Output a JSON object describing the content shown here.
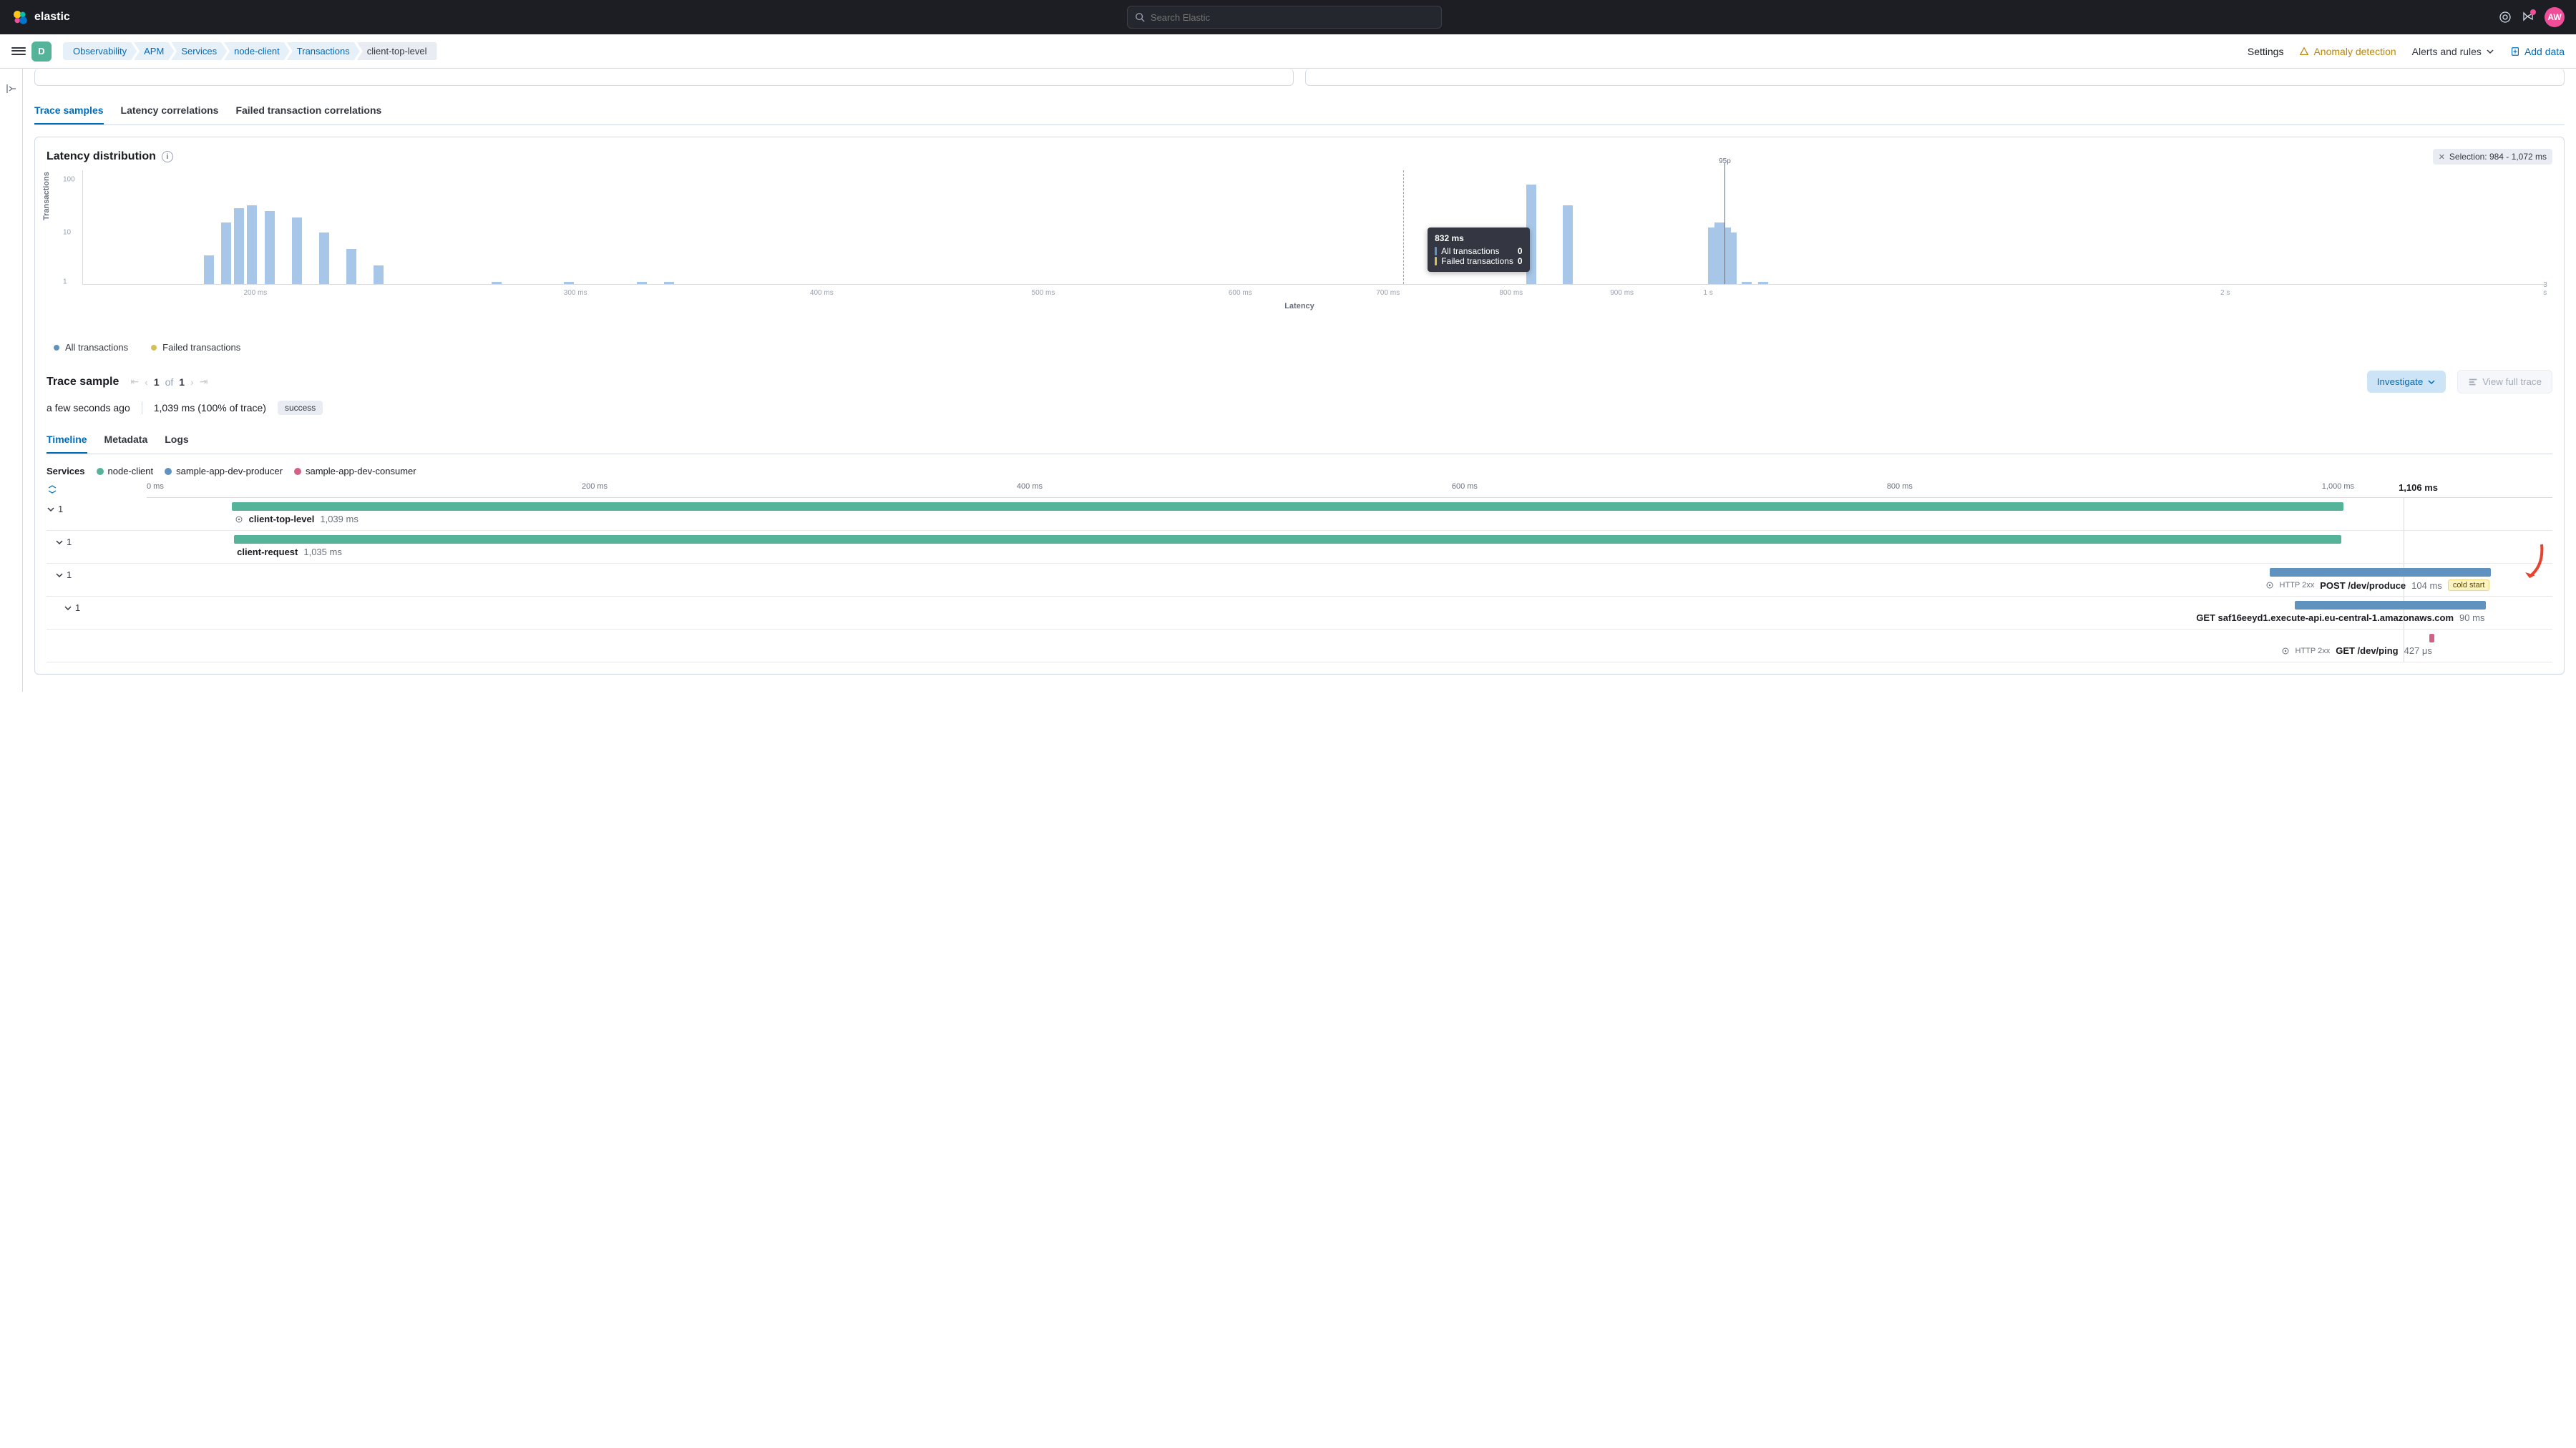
{
  "header": {
    "logo_text": "elastic",
    "search_placeholder": "Search Elastic",
    "avatar_initials": "AW"
  },
  "subheader": {
    "space_initial": "D",
    "breadcrumbs": [
      "Observability",
      "APM",
      "Services",
      "node-client",
      "Transactions",
      "client-top-level"
    ],
    "links": {
      "settings": "Settings",
      "anomaly": "Anomaly detection",
      "alerts": "Alerts and rules",
      "add_data": "Add data"
    }
  },
  "topTabs": [
    "Trace samples",
    "Latency correlations",
    "Failed transaction correlations"
  ],
  "latencyPanel": {
    "title": "Latency distribution",
    "selection_label": "Selection: 984 - 1,072 ms",
    "y_label": "Transactions",
    "x_label": "Latency",
    "p95_label": "95p",
    "tooltip": {
      "head": "832 ms",
      "rows": [
        [
          "All transactions",
          "0"
        ],
        [
          "Failed transactions",
          "0"
        ]
      ]
    },
    "legend": [
      "All transactions",
      "Failed transactions"
    ]
  },
  "chart_data": {
    "type": "bar",
    "x_ticks": [
      "200 ms",
      "300 ms",
      "400 ms",
      "500 ms",
      "600 ms",
      "700 ms",
      "800 ms",
      "900 ms",
      "1 s",
      "2 s",
      "3 s"
    ],
    "y_ticks": [
      "1",
      "10",
      "100"
    ],
    "yscale": "log",
    "series": [
      {
        "name": "All transactions",
        "color": "#a8c7e8",
        "values": [
          {
            "x": "140 ms",
            "y": 3
          },
          {
            "x": "160 ms",
            "y": 12
          },
          {
            "x": "175 ms",
            "y": 22
          },
          {
            "x": "190 ms",
            "y": 25
          },
          {
            "x": "205 ms",
            "y": 20
          },
          {
            "x": "220 ms",
            "y": 15
          },
          {
            "x": "235 ms",
            "y": 8
          },
          {
            "x": "250 ms",
            "y": 4
          },
          {
            "x": "265 ms",
            "y": 2
          },
          {
            "x": "330 ms",
            "y": 1
          },
          {
            "x": "370 ms",
            "y": 1
          },
          {
            "x": "410 ms",
            "y": 1
          },
          {
            "x": "425 ms",
            "y": 1
          },
          {
            "x": "900 ms",
            "y": 60
          },
          {
            "x": "920 ms",
            "y": 25
          },
          {
            "x": "1000 ms",
            "y": 10
          },
          {
            "x": "1015 ms",
            "y": 12
          },
          {
            "x": "1030 ms",
            "y": 10
          },
          {
            "x": "1045 ms",
            "y": 8
          },
          {
            "x": "1080 ms",
            "y": 1
          },
          {
            "x": "1120 ms",
            "y": 1
          }
        ]
      },
      {
        "name": "Failed transactions",
        "color": "#d6bf57",
        "values": []
      }
    ],
    "p95": "1040 ms",
    "dashed_marker": "832 ms"
  },
  "traceSample": {
    "title": "Trace sample",
    "pager_current": "1",
    "pager_of": "of",
    "pager_total": "1",
    "investigate": "Investigate",
    "view_full": "View full trace",
    "time_ago": "a few seconds ago",
    "duration": "1,039 ms",
    "pct": "(100% of trace)",
    "status": "success",
    "tabs": [
      "Timeline",
      "Metadata",
      "Logs"
    ],
    "services_label": "Services",
    "services": [
      {
        "name": "node-client",
        "color": "#54b399"
      },
      {
        "name": "sample-app-dev-producer",
        "color": "#6092c0"
      },
      {
        "name": "sample-app-dev-consumer",
        "color": "#d36086"
      }
    ],
    "time_ticks": [
      "0 ms",
      "200 ms",
      "400 ms",
      "600 ms",
      "800 ms",
      "1,000 ms"
    ],
    "time_max": "1,106 ms"
  },
  "waterfall": [
    {
      "depth": 0,
      "count": "1",
      "name": "client-top-level",
      "duration": "1,039 ms",
      "start_pct": 5.5,
      "width_pct": 86,
      "color": "#54b399",
      "icon": true
    },
    {
      "depth": 1,
      "count": "1",
      "name": "client-request",
      "duration": "1,035 ms",
      "start_pct": 5.6,
      "width_pct": 85.8,
      "color": "#54b399"
    },
    {
      "depth": 1,
      "count": "1",
      "name": "POST /dev/produce",
      "http": "HTTP 2xx",
      "duration": "104 ms",
      "start_pct": 88.5,
      "width_pct": 9,
      "color": "#6092c0",
      "cold_start": "cold start",
      "icon": true
    },
    {
      "depth": 2,
      "count": "1",
      "name": "GET saf16eeyd1.execute-api.eu-central-1.amazonaws.com",
      "duration": "90 ms",
      "start_pct": 89.5,
      "width_pct": 7.8,
      "color": "#6092c0"
    },
    {
      "depth": 2,
      "count": "",
      "name": "GET /dev/ping",
      "http": "HTTP 2xx",
      "duration": "427 μs",
      "start_pct": 95,
      "width_pct": 0.2,
      "color": "#d36086",
      "icon": true
    }
  ]
}
